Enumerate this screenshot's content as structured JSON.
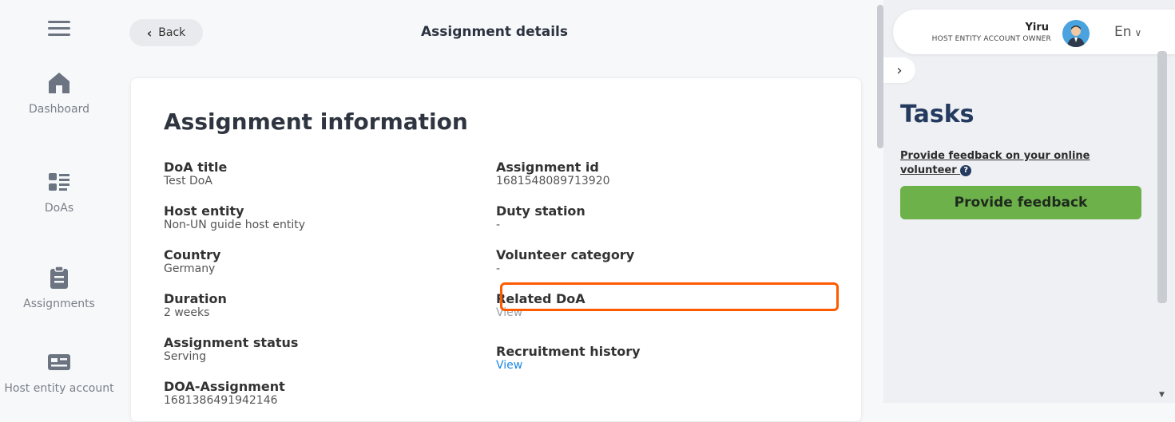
{
  "sidebar": {
    "items": [
      {
        "label": "Dashboard",
        "icon": "home-icon"
      },
      {
        "label": "DoAs",
        "icon": "list-icon"
      },
      {
        "label": "Assignments",
        "icon": "clipboard-icon"
      },
      {
        "label": "Host entity account",
        "icon": "id-card-icon"
      }
    ]
  },
  "header": {
    "back_label": "Back",
    "title": "Assignment details"
  },
  "card": {
    "title": "Assignment information",
    "left_fields": [
      {
        "label": "DoA title",
        "value": "Test DoA"
      },
      {
        "label": "Host entity",
        "value": "Non-UN guide host entity"
      },
      {
        "label": "Country",
        "value": "Germany"
      },
      {
        "label": "Duration",
        "value": "2 weeks"
      },
      {
        "label": "Assignment status",
        "value": "Serving"
      },
      {
        "label": "DOA-Assignment",
        "value": "1681386491942146"
      }
    ],
    "right_fields": [
      {
        "label": "Assignment id",
        "value": "1681548089713920"
      },
      {
        "label": "Duty station",
        "value": "-"
      },
      {
        "label": "Volunteer category",
        "value": "-"
      },
      {
        "label": "Related DoA",
        "value": "View"
      },
      {
        "label": "Recruitment history",
        "value": "View"
      }
    ]
  },
  "user": {
    "name": "Yiru",
    "role": "HOST ENTITY ACCOUNT OWNER",
    "language": "En"
  },
  "tasks": {
    "title": "Tasks",
    "link_text": "Provide feedback on your online volunteer",
    "button_label": "Provide feedback"
  },
  "colors": {
    "accent_green": "#6db14a",
    "highlight_orange": "#ff5a00",
    "link_blue": "#1e88e5",
    "tasks_navy": "#243a5e"
  }
}
